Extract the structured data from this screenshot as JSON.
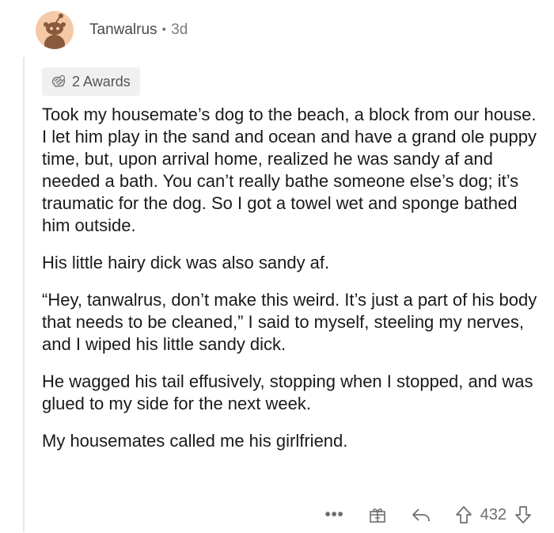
{
  "comment": {
    "username": "Tanwalrus",
    "separator": "•",
    "age": "3d",
    "awards_label": "2 Awards",
    "paragraphs": [
      "Took my housemate’s dog to the beach, a block from our house. I let him play in the sand and ocean and have a grand ole puppy time, but, upon arrival home, realized he was sandy af and needed a bath. You can’t really bathe someone else’s dog; it’s traumatic for the dog. So I got a towel wet and sponge bathed him outside.",
      "His little hairy dick was also sandy af.",
      "“Hey, tanwalrus, don’t make this weird. It’s just a part of his body that needs to be cleaned,” I said to myself, steeling my nerves, and I wiped his little sandy dick.",
      "He wagged his tail effusively, stopping when I stopped, and was glued to my side for the next week.",
      "My housemates called me his girlfriend."
    ],
    "actions": {
      "more_label": "•••",
      "score": "432"
    }
  },
  "colors": {
    "avatar_bg": "#f6c9a6",
    "avatar_figure": "#8a5a3c",
    "meta_text": "#7c7c7c",
    "award_bg": "#f0f0f0"
  },
  "icons": {
    "avatar": "reddit-snoo-avatar",
    "award": "award-icon",
    "gift": "gift-icon",
    "reply": "reply-arrow-icon",
    "upvote": "upvote-arrow-icon",
    "downvote": "downvote-arrow-icon"
  }
}
